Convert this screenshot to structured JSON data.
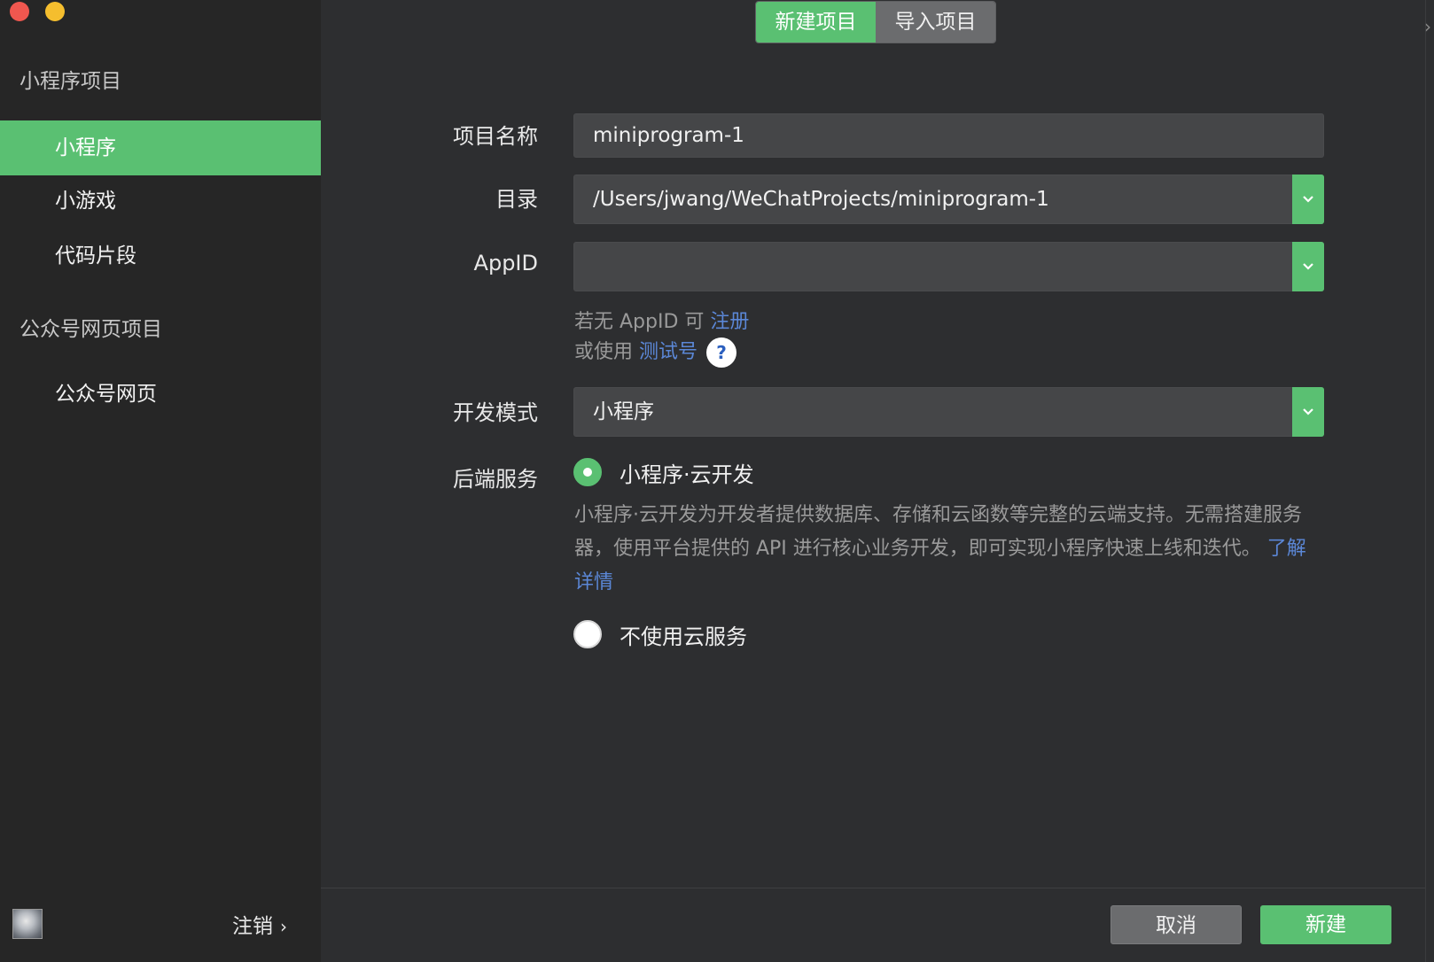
{
  "sidebar": {
    "section1_title": "小程序项目",
    "items": [
      {
        "label": "小程序",
        "active": true
      },
      {
        "label": "小游戏",
        "active": false
      },
      {
        "label": "代码片段",
        "active": false
      }
    ],
    "section2_title": "公众号网页项目",
    "items2": [
      {
        "label": "公众号网页",
        "active": false
      }
    ],
    "logout_label": "注销",
    "logout_chevron": "›"
  },
  "header": {
    "tabs": [
      {
        "label": "新建项目",
        "active": true
      },
      {
        "label": "导入项目",
        "active": false
      }
    ]
  },
  "form": {
    "project_name": {
      "label": "项目名称",
      "value": "miniprogram-1"
    },
    "directory": {
      "label": "目录",
      "value": "/Users/jwang/WeChatProjects/miniprogram-1"
    },
    "appid": {
      "label": "AppID",
      "value": ""
    },
    "appid_hint_prefix": "若无 AppID 可",
    "appid_register_link": "注册",
    "appid_hint2_prefix": "或使用",
    "appid_test_link": "测试号",
    "help_icon": "?",
    "dev_mode": {
      "label": "开发模式",
      "value": "小程序"
    },
    "backend": {
      "label": "后端服务",
      "options": [
        {
          "label": "小程序·云开发",
          "selected": true
        },
        {
          "label": "不使用云服务",
          "selected": false
        }
      ],
      "description": "小程序·云开发为开发者提供数据库、存储和云函数等完整的云端支持。无需搭建服务器，使用平台提供的 API 进行核心业务开发，即可实现小程序快速上线和迭代。",
      "learn_more_link": "了解详情"
    }
  },
  "footer": {
    "cancel_label": "取消",
    "create_label": "新建"
  },
  "colors": {
    "accent": "#5ac072",
    "sidebar_bg": "#262626",
    "main_bg": "#2d2e30",
    "link": "#5b87d6"
  }
}
